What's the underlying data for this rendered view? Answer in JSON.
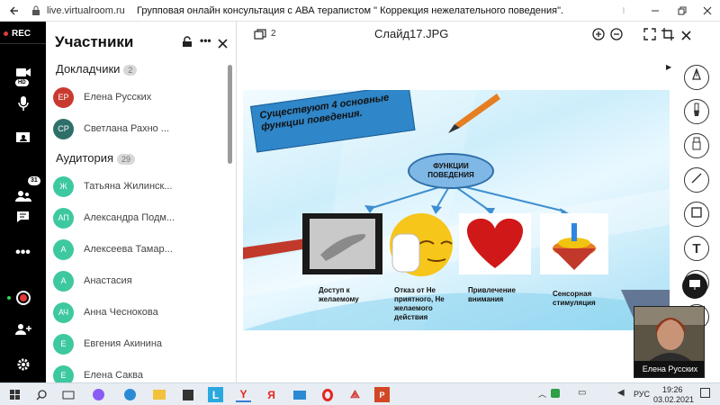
{
  "browser": {
    "url": "live.virtualroom.ru",
    "title": "Групповая онлайн консультация с АВА терапистом \" Коррекция нежелательного поведения\"."
  },
  "rail": {
    "rec_label": "REC",
    "hd_label": "HD",
    "participants_count": "31"
  },
  "participants": {
    "title": "Участники",
    "speakers_label": "Докладчики",
    "speakers_count": "2",
    "audience_label": "Аудитория",
    "audience_count": "29",
    "speakers": [
      {
        "initials": "ЕР",
        "name": "Елена Русских",
        "color": "#c83a2f"
      },
      {
        "initials": "СР",
        "name": "Светлана Рахно ...",
        "color": "#2f6f6a"
      }
    ],
    "audience": [
      {
        "initials": "Ж",
        "name": "Татьяна Жилинск...",
        "color": "#3ec8a0"
      },
      {
        "initials": "АП",
        "name": "Александра Подм...",
        "color": "#3ec8a0"
      },
      {
        "initials": "А",
        "name": "Алексеева Тамар...",
        "color": "#3ec8a0"
      },
      {
        "initials": "А",
        "name": "Анастасия",
        "color": "#3ec8a0"
      },
      {
        "initials": "АЧ",
        "name": "Анна Чеснокова",
        "color": "#3ec8a0"
      },
      {
        "initials": "Е",
        "name": "Евгения Акинина",
        "color": "#3ec8a0"
      },
      {
        "initials": "Е",
        "name": "Елена Саква",
        "color": "#3ec8a0"
      }
    ]
  },
  "viewer": {
    "page_count": "2",
    "file_name": "Слайд17.JPG"
  },
  "slide": {
    "banner": "Существуют 4 основные функции поведения.",
    "center": "ФУНКЦИИ ПОВЕДЕНИЯ",
    "captions": [
      "Доступ к желаемому",
      "Отказ от Не приятного, Не желаемого действия",
      "Привлечение внимания",
      "Сенсорная стимуляция"
    ]
  },
  "video": {
    "name": "Елена Русских"
  },
  "tools": {
    "text_tool_glyph": "T"
  },
  "taskbar": {
    "lang": "РУС",
    "time": "19:26",
    "date": "03.02.2021"
  }
}
